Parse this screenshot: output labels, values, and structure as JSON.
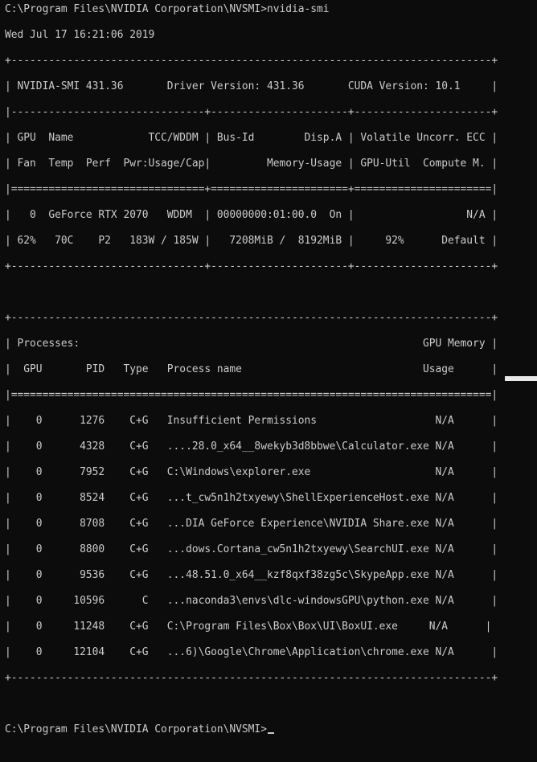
{
  "terminal": {
    "lines": [
      "C:\\Program Files\\NVIDIA Corporation\\NVSMI>nvidia-smi",
      "Wed Jul 17 16:21:06 2019",
      "+-----------------------------------------------------------------------------+",
      "| NVIDIA-SMI 431.36       Driver Version: 431.36       CUDA Version: 10.1     |",
      "|-------------------------------+----------------------+----------------------+",
      "| GPU  Name            TCC/WDDM | Bus-Id        Disp.A | Volatile Uncorr. ECC |",
      "| Fan  Temp  Perf  Pwr:Usage/Cap|         Memory-Usage | GPU-Util  Compute M. |",
      "|===============================+======================+======================|",
      "|   0  GeForce RTX 2070   WDDM  | 00000000:01:00.0  On |                  N/A |",
      "| 62%   70C    P2   183W / 185W |   7208MiB /  8192MiB |     92%      Default |",
      "+-------------------------------+----------------------+----------------------+",
      "",
      "+-----------------------------------------------------------------------------+",
      "| Processes:                                                       GPU Memory |",
      "|  GPU       PID   Type   Process name                             Usage      |",
      "|=============================================================================|",
      "|    0      1276    C+G   Insufficient Permissions                   N/A      |",
      "|    0      4328    C+G   ....28.0_x64__8wekyb3d8bbwe\\Calculator.exe N/A      |",
      "|    0      7952    C+G   C:\\Windows\\explorer.exe                    N/A      |",
      "|    0      8524    C+G   ...t_cw5n1h2txyewy\\ShellExperienceHost.exe N/A      |",
      "|    0      8708    C+G   ...DIA GeForce Experience\\NVIDIA Share.exe N/A      |",
      "|    0      8800    C+G   ...dows.Cortana_cw5n1h2txyewy\\SearchUI.exe N/A      |",
      "|    0      9536    C+G   ...48.51.0_x64__kzf8qxf38zg5c\\SkypeApp.exe N/A      |",
      "|    0     10596      C   ...naconda3\\envs\\dlc-windowsGPU\\python.exe N/A      |",
      "|    0     11248    C+G   C:\\Program Files\\Box\\Box\\UI\\BoxUI.exe     N/A      |",
      "|    0     12104    C+G   ...6)\\Google\\Chrome\\Application\\chrome.exe N/A      |",
      "+-----------------------------------------------------------------------------+",
      "",
      "C:\\Program Files\\NVIDIA Corporation\\NVSMI>"
    ]
  },
  "colors": {
    "background": "#0c0c0c",
    "foreground": "#cccccc"
  }
}
